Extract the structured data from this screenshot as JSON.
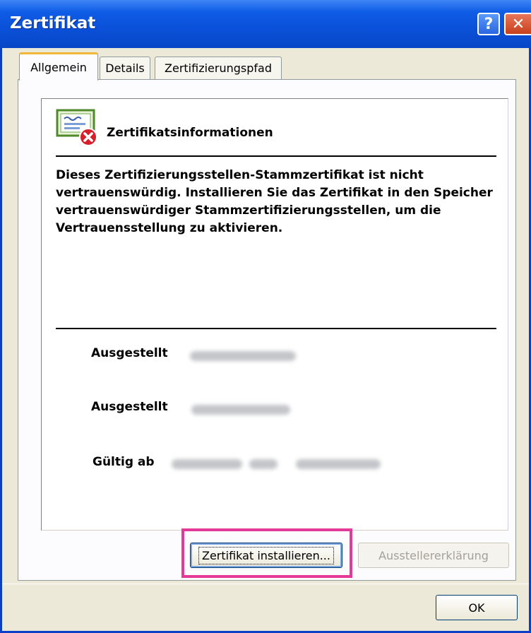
{
  "window": {
    "title": "Zertifikat",
    "help_glyph": "?",
    "close_glyph": "✕"
  },
  "tabs": [
    {
      "label": "Allgemein",
      "active": true
    },
    {
      "label": "Details",
      "active": false
    },
    {
      "label": "Zertifizierungspfad",
      "active": false
    }
  ],
  "info": {
    "heading": "Zertifikatsinformationen",
    "icon": "certificate-error-icon",
    "message": "Dieses Zertifizierungsstellen-Stammzertifikat ist nicht vertrauenswürdig. Installieren Sie das Zertifikat in den Speicher vertrauenswürdiger Stammzertifizierungsstellen, um die Vertrauensstellung zu aktivieren."
  },
  "fields": {
    "issued_to_label": "Ausgestellt",
    "issued_by_label": "Ausgestellt",
    "valid_from_label": "Gültig ab"
  },
  "buttons": {
    "install": "Zertifikat installieren...",
    "issuer_statement": "Ausstellererklärung",
    "ok": "OK"
  },
  "colors": {
    "titlebar": "#0a50d8",
    "highlight": "#e5399a",
    "dialog_bg": "#ece9d8"
  }
}
